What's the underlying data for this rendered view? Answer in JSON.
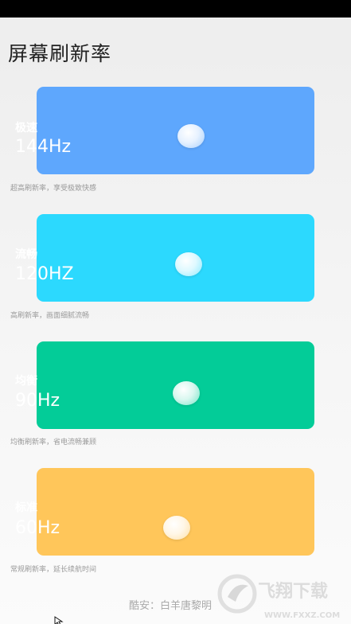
{
  "title": "屏幕刷新率",
  "modes": [
    {
      "name": "极速",
      "hz": "144Hz",
      "desc": "超高刷新率，享受极致快感",
      "color": "#5ea7fd"
    },
    {
      "name": "流畅",
      "hz": "120HZ",
      "desc": "高刷新率，画面细腻流畅",
      "color": "#2cd9fe"
    },
    {
      "name": "均衡",
      "hz": "90Hz",
      "desc": "均衡刷新率，省电流畅兼顾",
      "color": "#03cc98"
    },
    {
      "name": "标准",
      "hz": "60Hz",
      "desc": "常规刷新率，延长续航时间",
      "color": "#ffc65a"
    }
  ],
  "footer": "酷安：白羊唐黎明",
  "watermark": {
    "brand": "飞翔下载",
    "url": "WWW.FXXZ.COM"
  }
}
